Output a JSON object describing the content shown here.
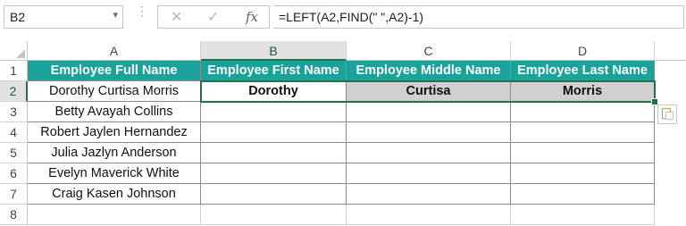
{
  "formula_bar": {
    "cell_ref": "B2",
    "formula": "=LEFT(A2,FIND(\" \",A2)-1)",
    "cancel_icon": "close-icon",
    "enter_icon": "check-icon",
    "function_label": "fx"
  },
  "columns": [
    "A",
    "B",
    "C",
    "D"
  ],
  "rows": [
    "1",
    "2",
    "3",
    "4",
    "5",
    "6",
    "7",
    "8"
  ],
  "table": {
    "headers": [
      "Employee Full Name",
      "Employee First Name",
      "Employee Middle Name",
      "Employee Last Name"
    ],
    "names": [
      "Dorothy Curtisa Morris",
      "Betty Avayah Collins",
      "Robert Jaylen Hernandez",
      "Julia Jazlyn Anderson",
      "Evelyn Maverick White",
      "Craig Kasen Johnson"
    ],
    "results": {
      "first": "Dorothy",
      "middle": "Curtisa",
      "last": "Morris"
    }
  },
  "colors": {
    "header_fill": "#1aa39a",
    "selection": "#217346",
    "result_fill": "#d0d0d0"
  }
}
